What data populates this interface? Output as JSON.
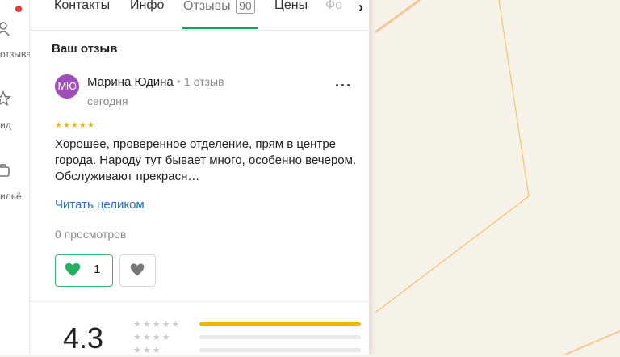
{
  "left_rail": {
    "items": [
      {
        "label": "отзыва",
        "icon": "people-icon"
      },
      {
        "label": "ид",
        "icon": "star-icon"
      },
      {
        "label": "ильё",
        "icon": "bag-icon"
      }
    ]
  },
  "tabs": [
    {
      "label": "Контакты"
    },
    {
      "label": "Инфо"
    },
    {
      "label": "Отзывы",
      "count": "90",
      "active": true
    },
    {
      "label": "Цены"
    },
    {
      "label": "Фо"
    }
  ],
  "section_title": "Ваш отзыв",
  "review": {
    "avatar_initials": "МЮ",
    "avatar_color": "#9c4fb6",
    "author": "Марина Юдина",
    "author_reviews": "1 отзыв",
    "date": "сегодня",
    "rating_stars": 5,
    "text": "Хорошее, проверенное отделение, прям в центре города. Народу тут бывает много, особенно вечером. Обслуживают прекрасн…",
    "read_more": "Читать целиком",
    "views": "0 просмотров",
    "likes": "1"
  },
  "rating": {
    "value": "4.3",
    "distribution": [
      {
        "stars": 5,
        "fraction": 1.0
      },
      {
        "stars": 4,
        "fraction": 0.0
      },
      {
        "stars": 3,
        "fraction": 0.0
      }
    ]
  },
  "colors": {
    "accent": "#1aa05b",
    "link": "#1b72d6",
    "star": "#f5b400",
    "map_bg": "#f7f2e8"
  }
}
